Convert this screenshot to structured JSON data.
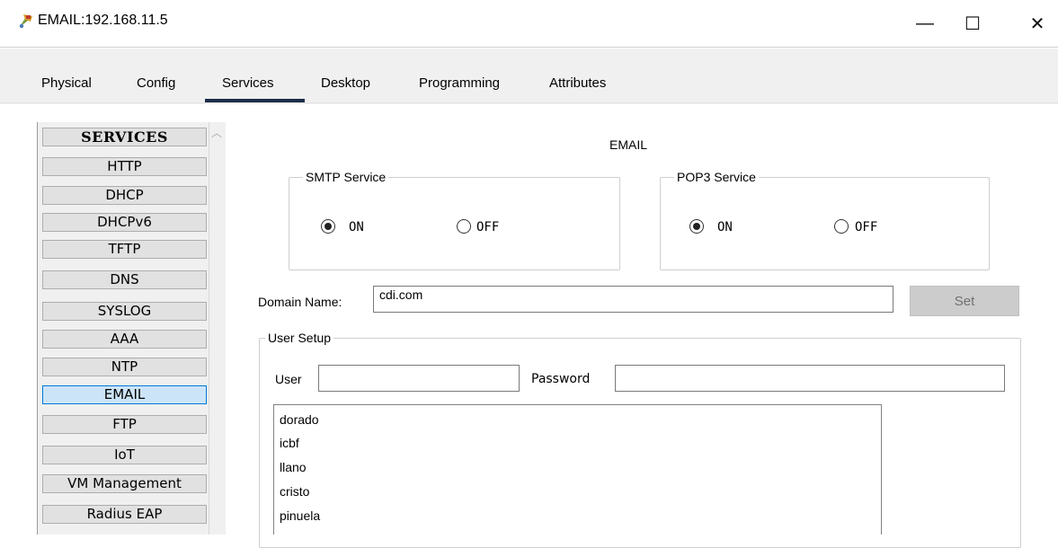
{
  "window": {
    "title": "EMAIL:192.168.11.5",
    "minimize_glyph": "—",
    "maximize_glyph": "☐",
    "close_glyph": "✕"
  },
  "tabs": [
    {
      "label": "Physical"
    },
    {
      "label": "Config"
    },
    {
      "label": "Services",
      "active": true
    },
    {
      "label": "Desktop"
    },
    {
      "label": "Programming"
    },
    {
      "label": "Attributes"
    }
  ],
  "services": {
    "header": "SERVICES",
    "items": [
      "HTTP",
      "DHCP",
      "DHCPv6",
      "TFTP",
      "DNS",
      "SYSLOG",
      "AAA",
      "NTP",
      "EMAIL",
      "FTP",
      "IoT",
      "VM Management",
      "Radius EAP"
    ],
    "selected": "EMAIL"
  },
  "email": {
    "heading": "EMAIL",
    "smtp": {
      "legend": "SMTP Service",
      "on_label": "ON",
      "off_label": "OFF",
      "value": "ON"
    },
    "pop3": {
      "legend": "POP3 Service",
      "on_label": "ON",
      "off_label": "OFF",
      "value": "ON"
    },
    "domain_label": "Domain Name:",
    "domain_value": "cdi.com",
    "set_label": "Set",
    "user_setup": {
      "legend": "User Setup",
      "user_label": "User",
      "user_value": "",
      "password_label": "Password",
      "password_value": "",
      "users": [
        "dorado",
        "icbf",
        "llano",
        "cristo",
        "pinuela"
      ]
    }
  },
  "colors": {
    "tab_underline": "#1c2e4a",
    "selected_item_bg": "#cce4f7",
    "selected_item_border": "#0078d7"
  },
  "icons": {
    "app": "packet-tracer-server-icon",
    "scroll_up": "chevron-up-icon"
  }
}
